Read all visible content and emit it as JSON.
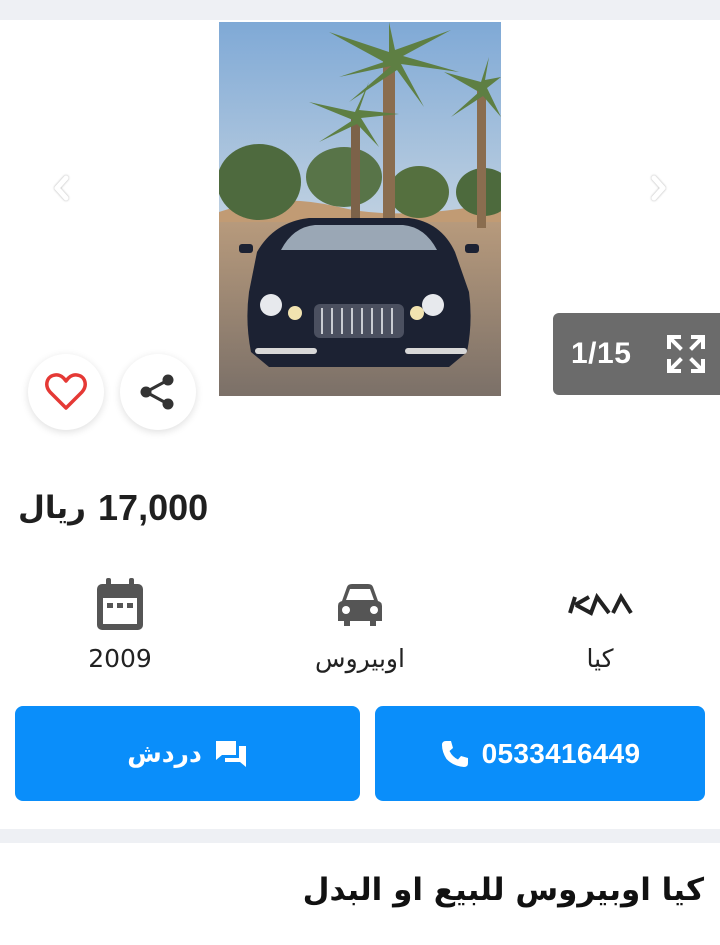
{
  "gallery": {
    "counter": "1/15",
    "prev_icon": "chevron-left-icon",
    "next_icon": "chevron-right-icon",
    "expand_icon": "fullscreen-expand-icon"
  },
  "actions": {
    "favorite_icon": "heart-outline-icon",
    "share_icon": "share-icon"
  },
  "listing": {
    "price": "17,000",
    "currency": "ريال",
    "year": "2009",
    "model": "اوبيروس",
    "brand": "كيا",
    "title": "كيا اوبيروس للبيع او البدل"
  },
  "spec_icons": {
    "year": "calendar-icon",
    "model": "car-icon",
    "brand": "kia-logo-icon"
  },
  "buttons": {
    "chat_label": "دردش",
    "chat_icon": "chat-bubbles-icon",
    "phone_label": "0533416449",
    "phone_icon": "phone-icon"
  },
  "colors": {
    "primary": "#0a8efa",
    "heart": "#e53935",
    "counter_bg": "#6b6b6b",
    "band": "#eef0f4"
  }
}
